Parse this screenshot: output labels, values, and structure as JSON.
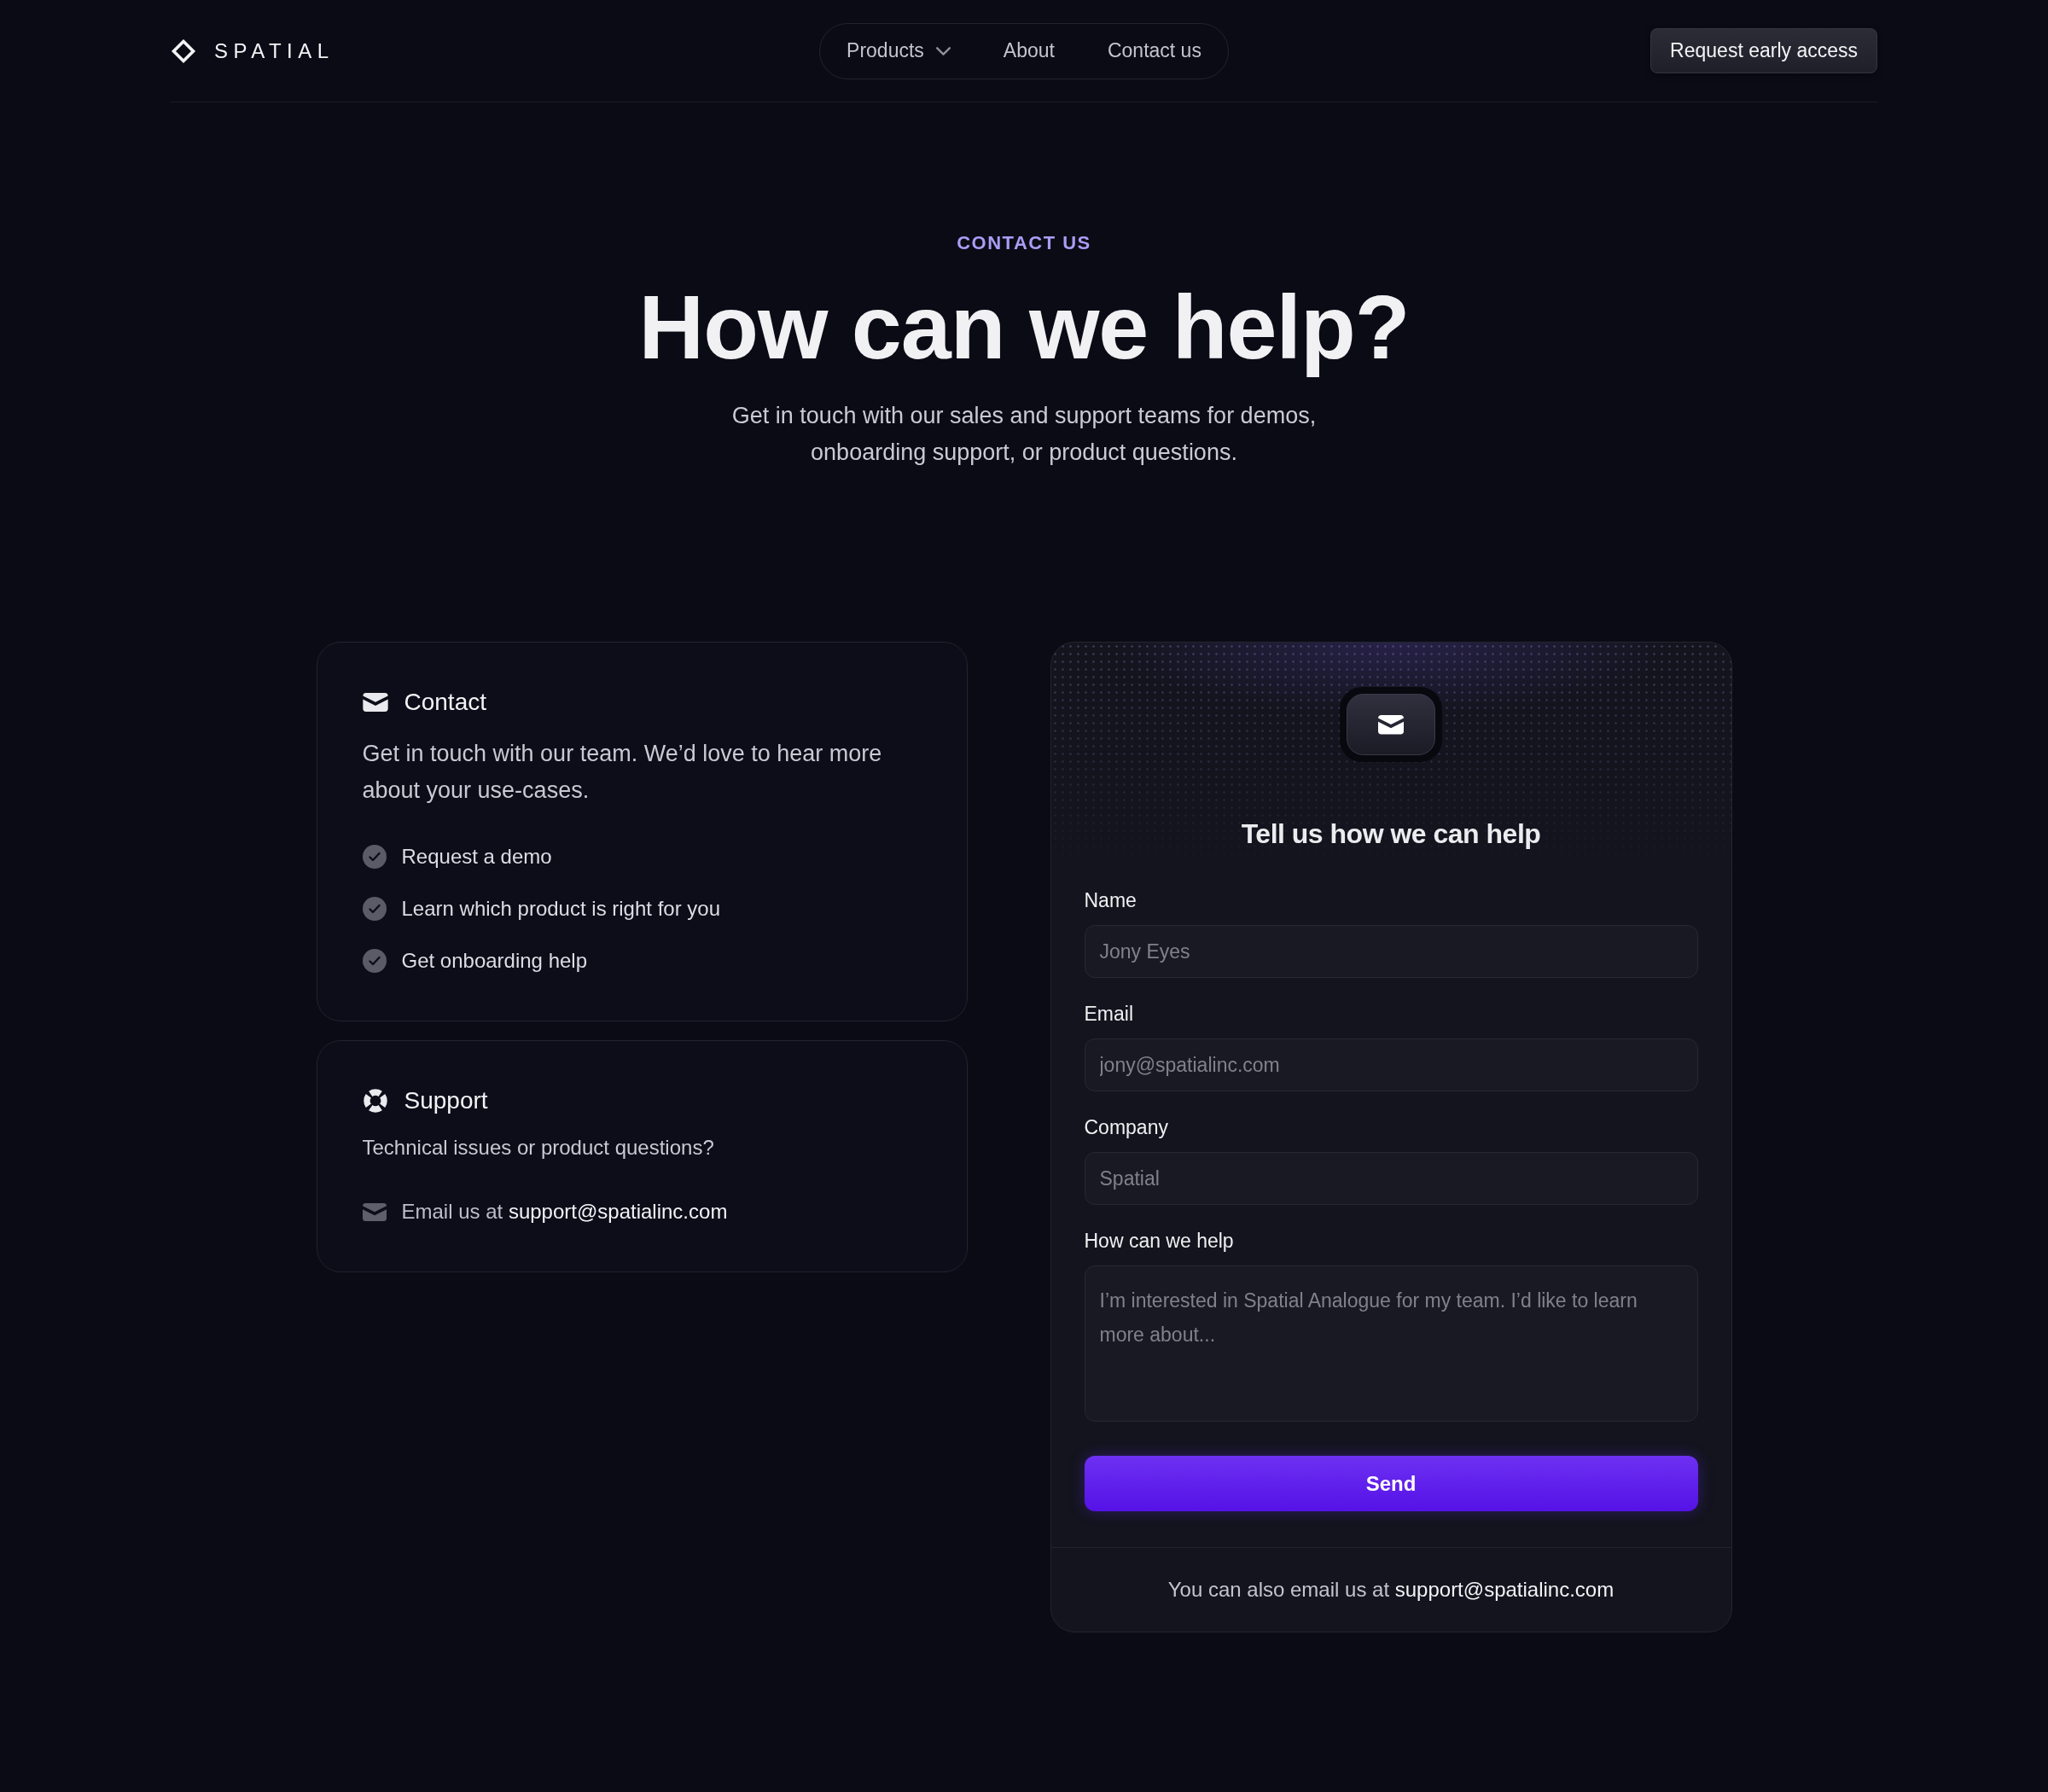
{
  "header": {
    "logo": "SPATIAL",
    "nav": [
      {
        "label": "Products",
        "kind": "dropdown"
      },
      {
        "label": "About",
        "kind": "link"
      },
      {
        "label": "Contact us",
        "kind": "link"
      }
    ],
    "cta": "Request early access"
  },
  "hero": {
    "eyebrow": "CONTACT US",
    "title": "How can we help?",
    "subtitle": "Get in touch with our sales and support teams for demos, onboarding support, or product questions."
  },
  "info_cards": [
    {
      "kind": "contact",
      "title": "Contact",
      "text": "Get in touch with our team. We’d love to hear more about your use-cases.",
      "items": [
        "Request a demo",
        "Learn which product is right for you",
        "Get onboarding help"
      ]
    },
    {
      "kind": "support",
      "title": "Support",
      "text": "Technical issues or product questions?",
      "email": {
        "prefix": "Email us at",
        "link": "support@spatialinc.com"
      }
    }
  ],
  "form": {
    "title": "Tell us how we can help",
    "fields": [
      {
        "kind": "text",
        "label": "Name",
        "placeholder": "Jony Eyes"
      },
      {
        "kind": "text",
        "label": "Email",
        "placeholder": "jony@spatialinc.com"
      },
      {
        "kind": "text",
        "label": "Company",
        "placeholder": "Spatial"
      },
      {
        "kind": "textarea",
        "label": "How can we help",
        "placeholder": "I’m interested in Spatial Analogue for my team. I’d like to learn more about..."
      }
    ],
    "submit": "Send",
    "footer": {
      "prefix": "You can also email us at",
      "link": "support@spatialinc.com"
    }
  }
}
